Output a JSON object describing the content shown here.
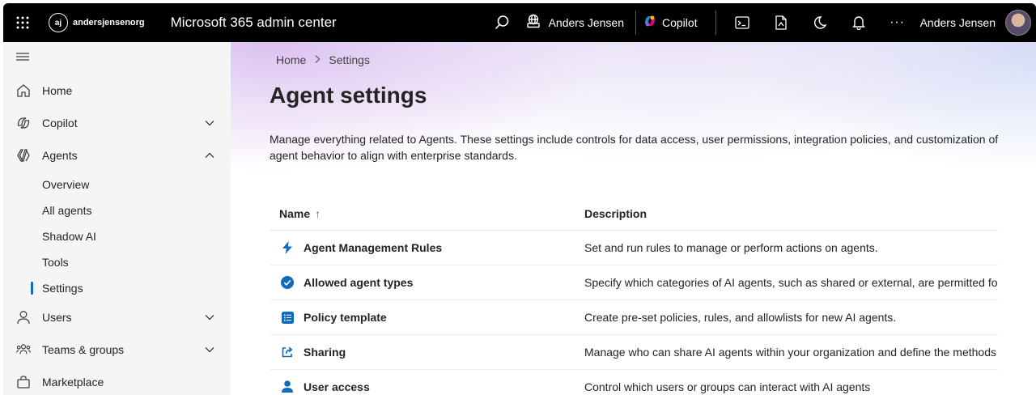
{
  "topbar": {
    "org_initials": "aj",
    "org_name": "andersjensenorg",
    "app_title": "Microsoft 365 admin center",
    "tenant_label": "Anders Jensen",
    "copilot_label": "Copilot",
    "more_label": "···",
    "user_name": "Anders Jensen"
  },
  "nav": {
    "items": [
      {
        "label": "Home"
      },
      {
        "label": "Copilot"
      },
      {
        "label": "Agents"
      },
      {
        "label": "Users"
      },
      {
        "label": "Teams & groups"
      },
      {
        "label": "Marketplace"
      }
    ],
    "agents_sub": [
      {
        "label": "Overview"
      },
      {
        "label": "All agents"
      },
      {
        "label": "Shadow AI"
      },
      {
        "label": "Tools"
      },
      {
        "label": "Settings",
        "active": true
      }
    ]
  },
  "breadcrumb": {
    "home": "Home",
    "current": "Settings"
  },
  "page": {
    "title": "Agent settings",
    "description": "Manage everything related to Agents. These settings include controls for data access, user permissions, integration policies, and customization of agent behavior to align with enterprise standards."
  },
  "table": {
    "col_name": "Name",
    "sort_indicator": "↑",
    "col_description": "Description",
    "rows": [
      {
        "name": "Agent Management Rules",
        "description": "Set and run rules to manage or perform actions on agents.",
        "icon": "bolt-icon"
      },
      {
        "name": "Allowed agent types",
        "description": "Specify which categories of AI agents, such as shared or external, are permitted for",
        "icon": "check-circle-icon"
      },
      {
        "name": "Policy template",
        "description": "Create pre-set policies, rules, and allowlists for new AI agents.",
        "icon": "list-icon"
      },
      {
        "name": "Sharing",
        "description": "Manage who can share AI agents within your organization and define the methods",
        "icon": "share-icon"
      },
      {
        "name": "User access",
        "description": "Control which users or groups can interact with AI agents",
        "icon": "person-icon"
      }
    ]
  },
  "colors": {
    "accent": "#0f6cbd",
    "topbar": "#000000",
    "nav_bg": "#f5f5f5"
  }
}
